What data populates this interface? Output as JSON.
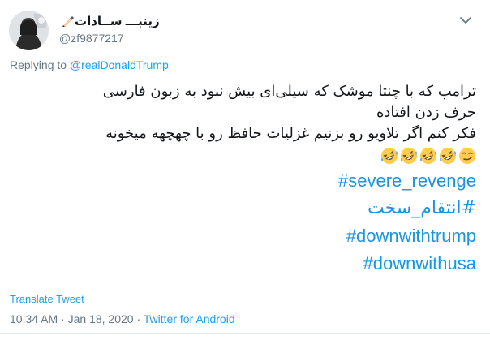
{
  "user": {
    "display_name": "زینبـــ ســادات",
    "handle": "@zf9877217",
    "name_emoji_icon": "writing-hand-icon"
  },
  "reply": {
    "prefix": "Replying to",
    "mention": "@realDonaldTrump"
  },
  "tweet": {
    "lines": [
      "ترامپ که با چنتا موشک که سیلی‌ای بیش نبود به زبون فارسی",
      "حرف زدن افتاده",
      "فکر کنم اگر تلاویو رو بزنیم غزلیات حافظ رو با چهچهه میخونه"
    ],
    "emojis": [
      "smirking-face-icon",
      "rolling-on-floor-laughing-icon",
      "rolling-on-floor-laughing-icon",
      "rolling-on-floor-laughing-icon",
      "rolling-on-floor-laughing-icon"
    ],
    "hashtags": [
      "#severe_revenge",
      "#انتقام_سخت",
      "#downwithtrump",
      "#downwithusa"
    ]
  },
  "footer": {
    "translate": "Translate Tweet",
    "time": "10:34 AM",
    "separator": " · ",
    "date": "Jan 18, 2020",
    "app": "Twitter for Android"
  },
  "colors": {
    "link": "#1b95e0",
    "secondary_text": "#657786",
    "text": "#14171a"
  }
}
